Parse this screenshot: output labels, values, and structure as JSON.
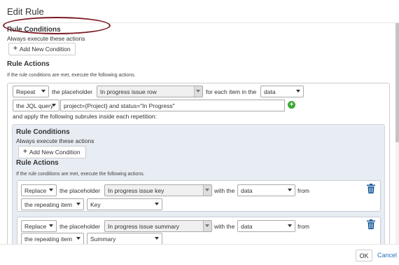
{
  "dialog": {
    "title": "Edit Rule"
  },
  "conditions": {
    "heading": "Rule Conditions",
    "subtitle": "Always execute these actions",
    "add_button": "Add New Condition"
  },
  "actions": {
    "heading": "Rule Actions",
    "subtitle": "If the rule conditions are met, execute the following actions.",
    "repeat_select": "Repeat",
    "placeholder_label": "the placeholder",
    "placeholder_select": "In progress issue row",
    "for_each_label": "for each item in the",
    "source_select": "data",
    "query_select": "the JQL query",
    "query_value": "project={Project} and status=\"In Progress\"",
    "subrules_text": "and apply the following subrules inside each repetition:"
  },
  "subrule": {
    "conditions_heading": "Rule Conditions",
    "conditions_subtitle": "Always execute these actions",
    "add_button": "Add New Condition",
    "actions_heading": "Rule Actions",
    "actions_subtitle": "If the rule conditions are met, execute the following actions.",
    "rows": [
      {
        "op": "Replace",
        "placeholder_label": "the placeholder",
        "placeholder": "In progress issue key",
        "with_label": "with the",
        "with_value": "data",
        "from_label": "from",
        "source": "the repeating item",
        "field": "Key"
      },
      {
        "op": "Replace",
        "placeholder_label": "the placeholder",
        "placeholder": "In progress issue summary",
        "with_label": "with the",
        "with_value": "data",
        "from_label": "from",
        "source": "the repeating item",
        "field": "Summary"
      }
    ]
  },
  "footer": {
    "ok": "OK",
    "cancel": "Cancel"
  },
  "icons": {
    "add": "plus-icon",
    "remove": "trash-icon",
    "add_param": "green-plus-icon"
  },
  "colors": {
    "highlight_ellipse": "#7b1a24",
    "link": "#2a6ebb",
    "trash": "#1f5f9c",
    "green": "#3aaa35"
  }
}
